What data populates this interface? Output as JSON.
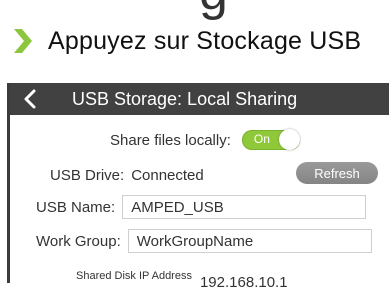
{
  "heading_fragment": "g",
  "instruction": {
    "text": "Appuyez sur Stockage USB",
    "bullet_color": "#8cc63f"
  },
  "screen": {
    "title": "USB Storage: Local Sharing",
    "back_icon": "chevron-left-icon",
    "share_locally": {
      "label": "Share files locally:",
      "toggle_state": "On",
      "toggle_color": "#8fc93a"
    },
    "usb_drive": {
      "label": "USB Drive:",
      "value": "Connected",
      "refresh_label": "Refresh"
    },
    "usb_name": {
      "label": "USB Name:",
      "value": "AMPED_USB"
    },
    "work_group": {
      "label": "Work Group:",
      "value": "WorkGroupName"
    },
    "shared_ip": {
      "label": "Shared Disk IP Address",
      "value": "192.168.10.1"
    }
  }
}
